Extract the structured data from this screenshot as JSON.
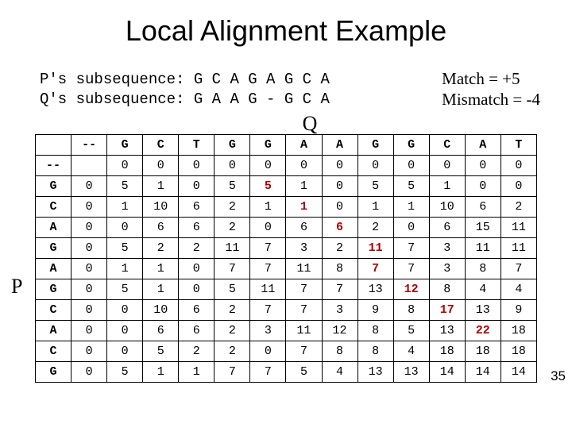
{
  "title": "Local Alignment Example",
  "seq_p_label": "P's subsequence: ",
  "seq_q_label": "Q's subsequence: ",
  "seq_p": "G C A G A G C A",
  "seq_q": "G A A G - G C A",
  "match_text": "Match = +5",
  "mismatch_text": "Mismatch = -4",
  "q_axis": "Q",
  "p_axis": "P",
  "col_headers": [
    "--",
    "G",
    "C",
    "T",
    "G",
    "G",
    "A",
    "A",
    "G",
    "G",
    "C",
    "A",
    "T"
  ],
  "row_headers": [
    "--",
    "G",
    "C",
    "A",
    "G",
    "A",
    "G",
    "C",
    "A",
    "C",
    "G"
  ],
  "rows": [
    [
      "",
      "0",
      "0",
      "0",
      "0",
      "0",
      "0",
      "0",
      "0",
      "0",
      "0",
      "0",
      "0"
    ],
    [
      "0",
      "5",
      "1",
      "0",
      "5",
      "5",
      "1",
      "0",
      "5",
      "5",
      "1",
      "0",
      "0"
    ],
    [
      "0",
      "1",
      "10",
      "6",
      "2",
      "1",
      "1",
      "0",
      "1",
      "1",
      "10",
      "6",
      "2"
    ],
    [
      "0",
      "0",
      "6",
      "6",
      "2",
      "0",
      "6",
      "6",
      "2",
      "0",
      "6",
      "15",
      "11"
    ],
    [
      "0",
      "5",
      "2",
      "2",
      "11",
      "7",
      "3",
      "2",
      "11",
      "7",
      "3",
      "11",
      "11"
    ],
    [
      "0",
      "1",
      "1",
      "0",
      "7",
      "7",
      "11",
      "8",
      "7",
      "7",
      "3",
      "8",
      "7"
    ],
    [
      "0",
      "5",
      "1",
      "0",
      "5",
      "11",
      "7",
      "7",
      "13",
      "12",
      "8",
      "4",
      "4"
    ],
    [
      "0",
      "0",
      "10",
      "6",
      "2",
      "7",
      "7",
      "3",
      "9",
      "8",
      "17",
      "13",
      "9"
    ],
    [
      "0",
      "0",
      "6",
      "6",
      "2",
      "3",
      "11",
      "12",
      "8",
      "5",
      "13",
      "22",
      "18"
    ],
    [
      "0",
      "0",
      "5",
      "2",
      "2",
      "0",
      "7",
      "8",
      "8",
      "4",
      "18",
      "18",
      "18"
    ],
    [
      "0",
      "5",
      "1",
      "1",
      "7",
      "7",
      "5",
      "4",
      "13",
      "13",
      "14",
      "14",
      "14"
    ]
  ],
  "highlight": {
    "1": [
      5
    ],
    "2": [
      6
    ],
    "3": [
      7
    ],
    "4": [
      8
    ],
    "5": [
      8
    ],
    "6": [
      9
    ],
    "7": [
      10
    ],
    "8": [
      11
    ]
  },
  "page_number": "35",
  "chart_data": {
    "type": "table",
    "title": "Local Alignment Example",
    "row_labels": [
      "--",
      "G",
      "C",
      "A",
      "G",
      "A",
      "G",
      "C",
      "A",
      "C",
      "G"
    ],
    "col_labels": [
      "--",
      "G",
      "C",
      "T",
      "G",
      "G",
      "A",
      "A",
      "G",
      "G",
      "C",
      "A",
      "T"
    ],
    "values": [
      [
        null,
        0,
        0,
        0,
        0,
        0,
        0,
        0,
        0,
        0,
        0,
        0,
        0
      ],
      [
        0,
        5,
        1,
        0,
        5,
        5,
        1,
        0,
        5,
        5,
        1,
        0,
        0
      ],
      [
        0,
        1,
        10,
        6,
        2,
        1,
        1,
        0,
        1,
        1,
        10,
        6,
        2
      ],
      [
        0,
        0,
        6,
        6,
        2,
        0,
        6,
        6,
        2,
        0,
        6,
        15,
        11
      ],
      [
        0,
        5,
        2,
        2,
        11,
        7,
        3,
        2,
        11,
        7,
        3,
        11,
        11
      ],
      [
        0,
        1,
        1,
        0,
        7,
        7,
        11,
        8,
        7,
        7,
        3,
        8,
        7
      ],
      [
        0,
        5,
        1,
        0,
        5,
        11,
        7,
        7,
        13,
        12,
        8,
        4,
        4
      ],
      [
        0,
        0,
        10,
        6,
        2,
        7,
        7,
        3,
        9,
        8,
        17,
        13,
        9
      ],
      [
        0,
        0,
        6,
        6,
        2,
        3,
        11,
        12,
        8,
        5,
        13,
        22,
        18
      ],
      [
        0,
        0,
        5,
        2,
        2,
        0,
        7,
        8,
        8,
        4,
        18,
        18,
        18
      ],
      [
        0,
        5,
        1,
        1,
        7,
        7,
        5,
        4,
        13,
        13,
        14,
        14,
        14
      ]
    ],
    "scoring": {
      "match": 5,
      "mismatch": -4
    }
  }
}
